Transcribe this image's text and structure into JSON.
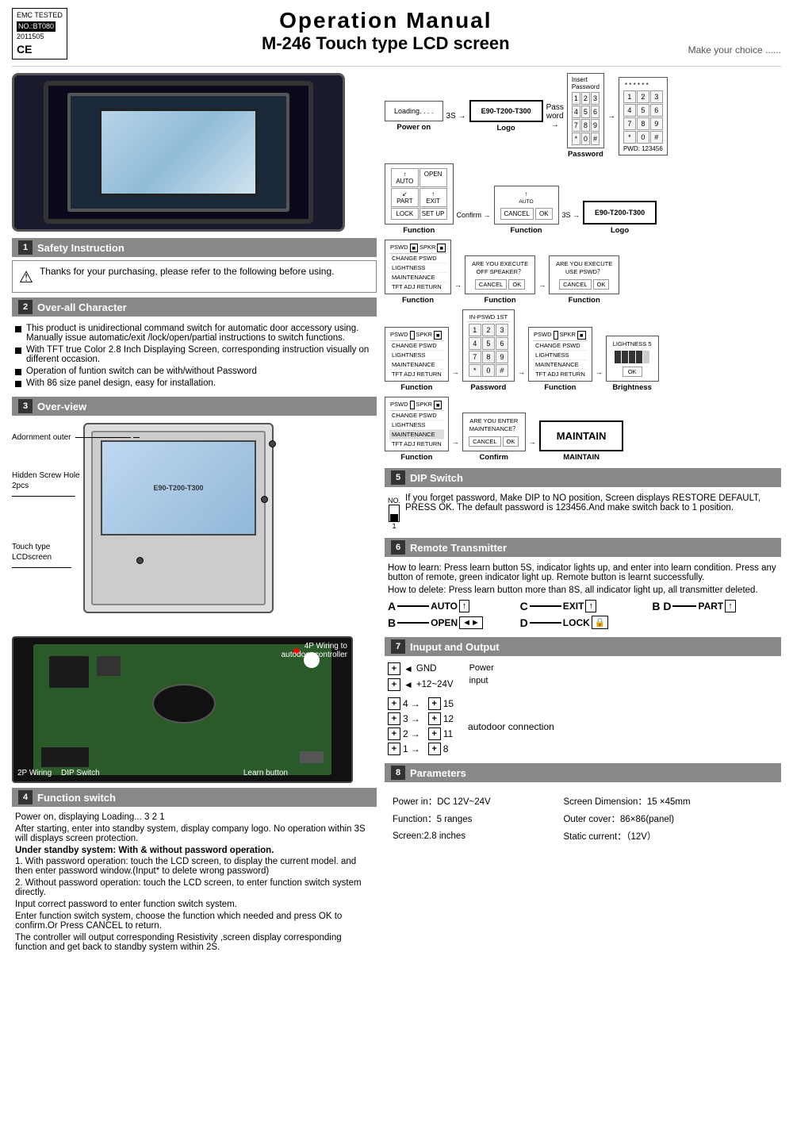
{
  "header": {
    "title": "Operation  Manual",
    "subtitle": "M-246 Touch type LCD screen",
    "tagline": "Make your choice ......",
    "emc": {
      "line1": "EMC TESTED",
      "line2": "NO.:BT080",
      "line3": "2011505",
      "ce": "CE"
    }
  },
  "sections": {
    "s1": {
      "number": "1",
      "title": "Safety Instruction"
    },
    "s2": {
      "number": "2",
      "title": "Over-all  Character"
    },
    "s3": {
      "number": "3",
      "title": "Over-view"
    },
    "s4": {
      "number": "4",
      "title": "Function  switch"
    },
    "s5": {
      "number": "5",
      "title": "DIP  Switch"
    },
    "s6": {
      "number": "6",
      "title": "Remote  Transmitter"
    },
    "s7": {
      "number": "7",
      "title": "Inuput  and  Output"
    },
    "s8": {
      "number": "8",
      "title": "Parameters"
    }
  },
  "safety": {
    "warning": "Thanks for your purchasing, please  refer to the following before using."
  },
  "characters": [
    "This product is unidirectional command switch for automatic door accessory using. Manually issue automatic/exit /lock/open/partial instructions to switch functions.",
    "With TFT  true Color 2.8 Inch  Displaying Screen, corresponding instruction visually on different occasion.",
    "Operation of funtion switch can be with/without Password",
    "With 86 size panel design, easy for installation."
  ],
  "overview": {
    "device_model": "E90-T200-T300",
    "labels": {
      "adornment": "Adornment outer",
      "screw_hole": "Hidden Screw Hole\n2pcs",
      "touch_type": "Touch type\nLCDscreen",
      "wiring_2p": "2P Wiring",
      "wiring_4p": "4P Wiring to\nautodoor controller",
      "dip_switch": "DIP  Switch",
      "learn_button": "Learn button"
    }
  },
  "function_switch": {
    "p1": "Power on,  displaying Loading... 3 2 1",
    "p2": "After starting, enter into standby system, display company  logo.       No operation within 3S will  displays screen protection.",
    "p3_title": "Under  standby system: With & without password operation.",
    "p3": "1. With password operation: touch the LCD screen, to        display the current model.  and then  enter password window.(Input* to delete wrong password)",
    "p4": "2. Without password operation: touch the LCD screen, to enter function switch system directly.",
    "p5": "Input  correct  password  to enter function switch system.",
    "p6": "Enter function switch system, choose the function which needed  and  press OK to confirm.Or Press CANCEL to return.",
    "p7": "The controller will output    corresponding   Resistivity ,screen display corresponding function and get back to standby system within 2S."
  },
  "dip_switch": {
    "text": "If you forget password, Make  DIP to NO position, Screen displays RESTORE DEFAULT, PRESS OK. The default password is 123456.And make switch back to 1 position.",
    "no_label": "NO.",
    "switch_label": "1"
  },
  "remote": {
    "p1": "How to learn: Press learn button 5S,  indicator lights up,  and enter into learn condition. Press  any  button  of  remote,  green indicator light up. Remote button is learnt successfully.",
    "p2": "How to delete: Press learn button more than 8S, all indicator light up, all transmitter deleted.",
    "channels": [
      {
        "letter": "A",
        "lines": 3,
        "label": "AUTO",
        "icon": "↑"
      },
      {
        "letter": "C",
        "lines": 3,
        "label": "EXIT",
        "icon": "↑"
      },
      {
        "letter": "B D",
        "lines": 3,
        "label": "PART",
        "icon": "↑"
      },
      {
        "letter": "B",
        "lines": 3,
        "label": "OPEN",
        "icon": "◄►"
      },
      {
        "letter": "D",
        "lines": 3,
        "label": "LOCK",
        "icon": "🔒"
      }
    ]
  },
  "io": {
    "power_rows": [
      {
        "symbol": "+",
        "arrow": "◄",
        "label": "GND"
      },
      {
        "symbol": "+",
        "arrow": "◄",
        "label": "+12~24V"
      }
    ],
    "power_note": "Power\ninput",
    "autodoor_rows": [
      {
        "num": "4",
        "sym2": "15"
      },
      {
        "num": "3",
        "sym2": "12"
      },
      {
        "num": "2",
        "sym2": "11"
      },
      {
        "num": "1",
        "sym2": "8"
      }
    ],
    "autodoor_note": "autodoor connection"
  },
  "parameters": {
    "left": [
      "Power in：DC 12V~24V",
      "Function：5 ranges",
      "Screen:2.8 inches"
    ],
    "right": [
      "Screen Dimension：15  ×45mm",
      "Outer cover：86×86(panel)",
      "Static  current：（12V）"
    ]
  },
  "flow_screens": {
    "row1": {
      "loading": "Loading. . . .",
      "time1": "3S",
      "logo": "E90-T200-T300",
      "pass_word": "Pass\nword",
      "insert_password": "Insert\nPassword",
      "pwd": "PWD: 123456",
      "labels": [
        "Power on",
        "Logo",
        "Password",
        ""
      ]
    }
  }
}
